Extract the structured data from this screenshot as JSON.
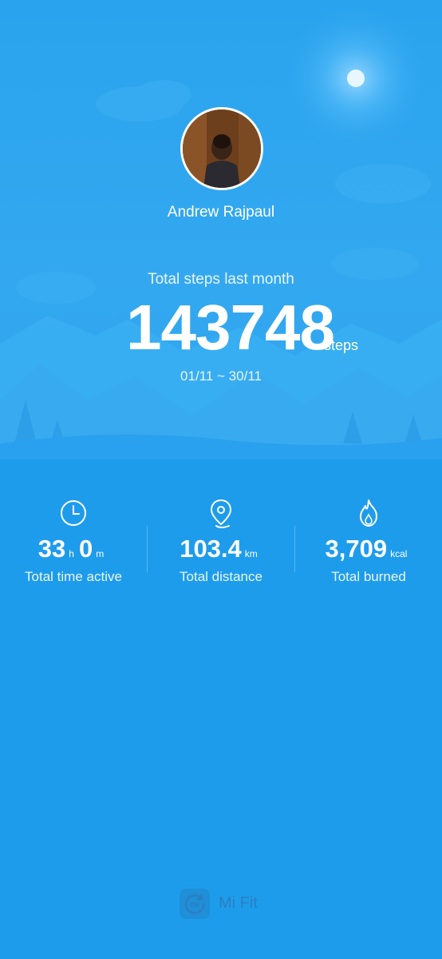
{
  "profile": {
    "name": "Andrew Rajpaul"
  },
  "summary": {
    "steps_label": "Total steps last month",
    "steps_value": "143748",
    "steps_unit": "steps",
    "date_range": "01/11 ~ 30/11"
  },
  "stats": [
    {
      "icon": "clock-icon",
      "value_a": "33",
      "unit_a": "h",
      "value_b": "0",
      "unit_b": "m",
      "label": "Total time active"
    },
    {
      "icon": "location-pin-icon",
      "value": "103.4",
      "unit": "km",
      "label": "Total distance"
    },
    {
      "icon": "flame-icon",
      "value": "3,709",
      "unit": "kcal",
      "label": "Total burned"
    }
  ],
  "footer": {
    "brand": "Mi Fit",
    "logo_text": "mi"
  },
  "colors": {
    "background": "#1e9cec",
    "hero": "#33a8f0",
    "text": "#ffffff"
  }
}
